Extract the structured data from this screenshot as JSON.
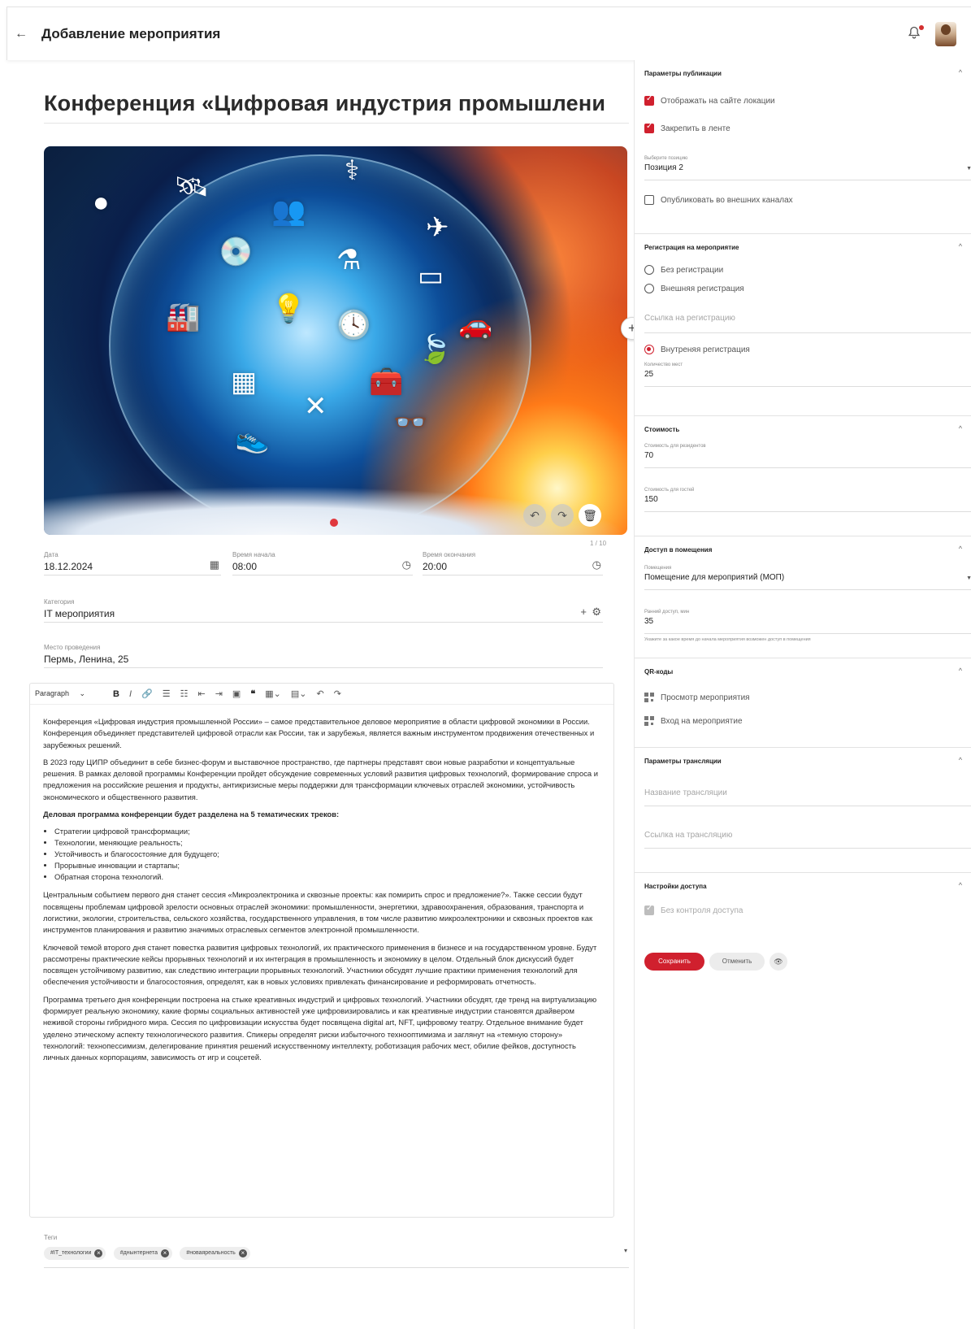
{
  "header": {
    "title": "Добавление мероприятия"
  },
  "event": {
    "title": "Конференция «Цифровая индустрия промышлени",
    "image_counter": "1 / 10",
    "date_label": "Дата",
    "date_value": "18.12.2024",
    "start_label": "Время начала",
    "start_value": "08:00",
    "end_label": "Время окончания",
    "end_value": "20:00",
    "category_label": "Категория",
    "category_value": "IT мероприятия",
    "place_label": "Место проведения",
    "place_value": "Пермь, Ленина, 25"
  },
  "editor": {
    "paragraph_select": "Paragraph",
    "p1": "Конференция «Цифровая индустрия промышленной России» – самое представительное деловое мероприятие в области цифровой экономики в России. Конференция объединяет представителей цифровой отрасли как России, так и зарубежья, является важным инструментом продвижения отечественных и зарубежных решений.",
    "p2": "В 2023 году ЦИПР объединит в себе бизнес-форум и выставочное пространство, где партнеры представят свои новые разработки и концептуальные решения. В рамках деловой программы Конференции пройдет обсуждение современных условий развития цифровых технологий, формирование спроса и предложения на российские решения и продукты, антикризисные меры поддержки для трансформации ключевых отраслей экономики, устойчивость экономического и общественного развития.",
    "p3": "Деловая программа конференции будет разделена на 5 тематических треков:",
    "list": [
      "Стратегии цифровой трансформации;",
      "Технологии, меняющие реальность;",
      "Устойчивость и благосостояние для будущего;",
      "Прорывные инновации и стартапы;",
      "Обратная сторона технологий."
    ],
    "p4": "Центральным событием первого дня станет сессия «Микроэлектроника и сквозные проекты: как помирить спрос и предложение?». Также сессии будут посвящены проблемам цифровой зрелости основных отраслей экономики: промышленности, энергетики, здравоохранения, образования, транспорта и логистики, экологии, строительства, сельского хозяйства, государственного управления, в том числе развитию микроэлектроники и сквозных проектов как инструментов планирования и развитию значимых отраслевых сегментов электронной промышленности.",
    "p5": "Ключевой темой второго дня станет повестка развития цифровых технологий, их практического применения в бизнесе и на государственном уровне. Будут рассмотрены практические кейсы прорывных технологий и их интеграция в промышленность и экономику в целом. Отдельный блок дискуссий будет посвящен устойчивому развитию, как следствию интеграции прорывных технологий. Участники обсудят лучшие практики применения технологий для обеспечения устойчивости и благосостояния, определят, как в новых условиях привлекать финансирование и реформировать отчетность.",
    "p6": "Программа третьего дня конференции построена на стыке креативных индустрий и цифровых технологий. Участники обсудят, где тренд на виртуализацию формирует реальную экономику, какие формы социальных активностей уже цифровизировались и как креативные индустрии становятся драйвером неживой стороны гибридного мира. Сессия по цифровизации искусства будет посвящена digital art, NFT, цифровому театру. Отдельное внимание будет уделено этическому аспекту технологического развития. Спикеры определят риски избыточного технооптимизма и заглянут на «темную сторону» технологий: технопессимизм, делегирование принятия решений искусственному интеллекту, роботизация рабочих мест, обилие фейков, доступность личных данных корпорациям, зависимость от игр и соцсетей."
  },
  "tags": {
    "label": "Теги",
    "items": [
      "#IT_технологии",
      "#днынтернета",
      "#новаяреальность"
    ]
  },
  "sidebar": {
    "publication": {
      "title": "Параметры публикации",
      "show_on_site": "Отображать на сайте локации",
      "pin_in_feed": "Закрепить в ленте",
      "position_label": "Выберите позицию",
      "position_value": "Позиция 2",
      "publish_external": "Опубликовать во внешних каналах"
    },
    "registration": {
      "title": "Регистрация на мероприятие",
      "none": "Без регистрации",
      "external": "Внешняя регистрация",
      "link_placeholder": "Ссылка на регистрацию",
      "internal": "Внутреняя регистрация",
      "seats_label": "Количество мест",
      "seats_value": "25"
    },
    "cost": {
      "title": "Стоимость",
      "residents_label": "Стоимость для резидентов",
      "residents_value": "70",
      "guests_label": "Стоимость для гостей",
      "guests_value": "150"
    },
    "access": {
      "title": "Доступ в помещения",
      "room_label": "Помещения",
      "room_value": "Помещение для мероприятий (МОП)",
      "early_label": "Ранний доступ, мин",
      "early_value": "35",
      "hint": "Укажите за какое время до начала мероприятия возможен доступ в помещения"
    },
    "qr": {
      "title": "QR-коды",
      "view": "Просмотр мероприятия",
      "entry": "Вход на мероприятие"
    },
    "stream": {
      "title": "Параметры трансляции",
      "name_placeholder": "Название трансляции",
      "link_placeholder": "Ссылка на трансляцию"
    },
    "access_settings": {
      "title": "Настройки доступа",
      "no_control": "Без контроля доступа"
    },
    "buttons": {
      "save": "Сохранить",
      "cancel": "Отменить"
    }
  },
  "colors": {
    "accent": "#d0202e"
  }
}
